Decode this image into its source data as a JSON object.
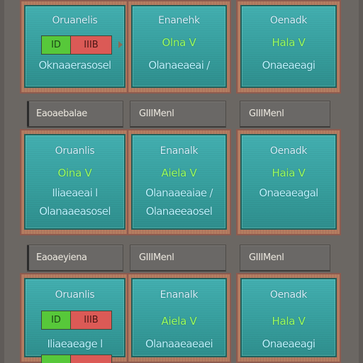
{
  "rows": [
    {
      "cells": [
        {
          "title": "Oruanelis",
          "toggle": {
            "on": "ID",
            "off": "IIIB"
          },
          "line": "Oknaaerasosel"
        },
        {
          "title": "Enanehk",
          "label": "Olna V",
          "line": "Olanaeaeai /"
        },
        {
          "title": "Oenadk",
          "label": "Hala V",
          "line": "Onaeaeagi"
        }
      ]
    },
    {
      "cells": [
        {
          "title": "Oruanlis",
          "label": "Oina V",
          "line": "Iliaeaeai l",
          "line2": "Olanaaeasosel"
        },
        {
          "title": "Enanalk",
          "label": "Aiela V",
          "line": "Olanaaeaiae /",
          "line2": "Olanaeeaosel"
        },
        {
          "title": "Oenadk",
          "label": "Haia V",
          "line": "Onaeaeagal"
        }
      ]
    },
    {
      "cells": [
        {
          "title": "Oruanlis",
          "toggle": {
            "on": "ID",
            "off": "IIIB"
          },
          "line": "Iliaeaeage l",
          "toggle2": {
            "on": "",
            "off": ""
          }
        },
        {
          "title": "Enanalk",
          "label": "Aiela V",
          "line": "Olanaaeaeaei"
        },
        {
          "title": "Oenadk",
          "label": "Hala V",
          "line": "Onaeaeagi"
        }
      ]
    }
  ],
  "tabs": [
    {
      "labels": [
        "Eaoaebalae",
        "GIIIMenl",
        "GIIIMenl"
      ]
    },
    {
      "labels": [
        "Eaoaeyiena",
        "GIIIMenl",
        "GIIIMenl"
      ]
    }
  ]
}
